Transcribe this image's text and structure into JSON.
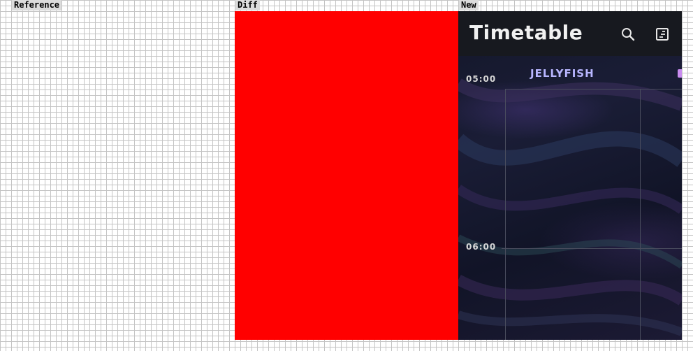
{
  "panels": {
    "reference_label": "Reference",
    "diff_label": "Diff",
    "new_label": "New"
  },
  "colors": {
    "diff_fill": "#ff0000",
    "appbar": "#17191f",
    "stage_name": "#b8b6ff"
  },
  "app": {
    "title": "Timetable",
    "search_icon": "search-icon",
    "notes_icon": "notes-icon"
  },
  "timetable": {
    "times": [
      "05:00",
      "06:00"
    ],
    "stages": [
      "JELLYFISH"
    ]
  }
}
